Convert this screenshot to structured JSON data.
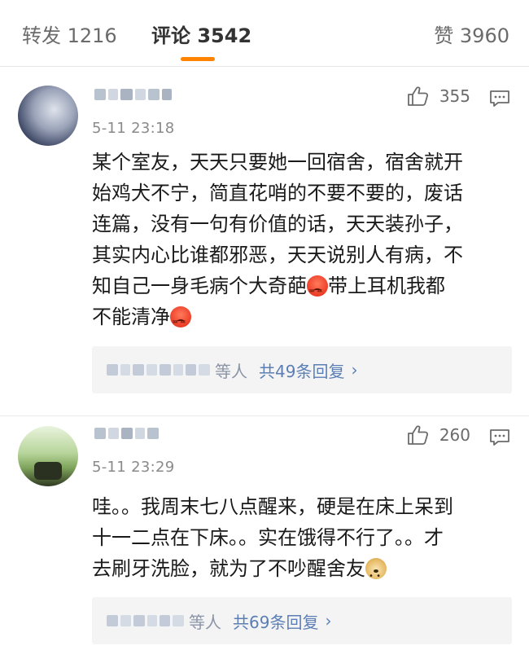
{
  "tabs": {
    "repost": "转发 1216",
    "comments": "评论 3542",
    "likes": "赞 3960"
  },
  "comments": [
    {
      "time": "5-11 23:18",
      "like_count": "355",
      "text": {
        "line1": "某个室友，天天只要她一回宿舍，宿舍就开",
        "line2": "始鸡犬不宁，简直花哨的不要不要的，废话",
        "line3": "连篇，没有一句有价值的话，天天装孙子，",
        "line4": "其实内心比谁都邪恶，天天说别人有病，不",
        "line5a": "知自己一身毛病个大奇葩",
        "line5b": "带上耳机我都",
        "line6": "不能清净"
      },
      "reply": {
        "tail": "等人",
        "link": "共49条回复",
        "chevron": "›"
      }
    },
    {
      "time": "5-11 23:29",
      "like_count": "260",
      "text": {
        "line1": "哇。。我周末七八点醒来，硬是在床上呆到",
        "line2": "十一二点在下床。。实在饿得不行了。。才",
        "line3": "去刷牙洗脸，就为了不吵醒舍友"
      },
      "reply": {
        "tail": "等人",
        "link": "共69条回复",
        "chevron": "›"
      }
    }
  ],
  "icons": {
    "like": "thumbs-up-icon",
    "comment": "comment-icon",
    "emoji_angry": "angry-face-emoji",
    "emoji_doge": "doge-emoji"
  },
  "colors": {
    "accent": "#ff8200",
    "link": "#5b7fb5",
    "reply_bg": "#f4f4f4"
  }
}
